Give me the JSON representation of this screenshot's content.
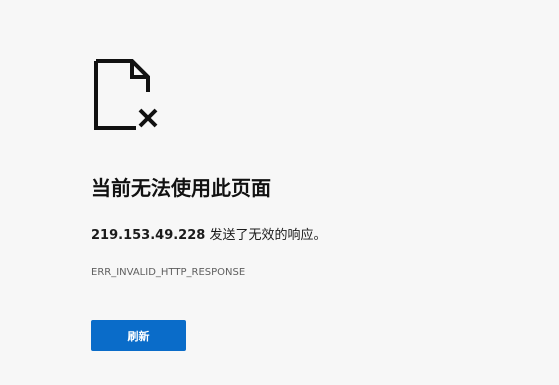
{
  "error": {
    "icon": "broken-document-icon",
    "headline": "当前无法使用此页面",
    "host": "219.153.49.228",
    "message": " 发送了无效的响应。",
    "code": "ERR_INVALID_HTTP_RESPONSE",
    "refresh_label": "刷新"
  },
  "colors": {
    "background": "#f7f7f7",
    "button": "#0a6cc9",
    "text": "#1b1b1b",
    "muted": "#5f5f5f"
  }
}
